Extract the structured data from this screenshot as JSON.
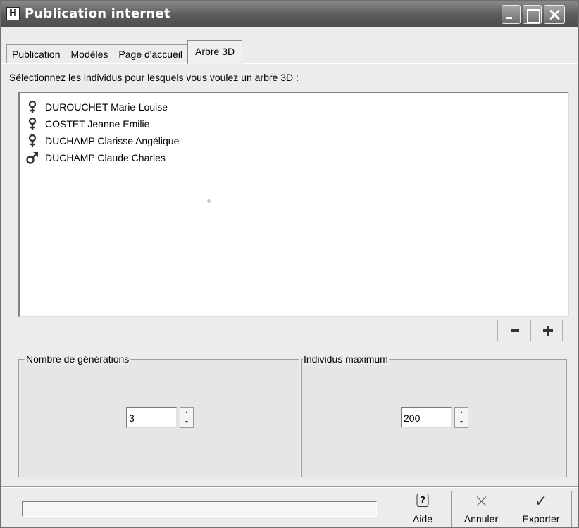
{
  "window": {
    "title": "Publication internet",
    "app_icon_glyph": "H"
  },
  "tabs": [
    {
      "label": "Publication",
      "active": false
    },
    {
      "label": "Modèles",
      "active": false
    },
    {
      "label": "Page d'accueil",
      "active": false
    },
    {
      "label": "Arbre 3D",
      "active": true
    }
  ],
  "instruction": "Sélectionnez les individus pour lesquels vous voulez un arbre 3D :",
  "individuals": [
    {
      "name": "DUROUCHET Marie-Louise",
      "sex": "female",
      "icon": "female-icon"
    },
    {
      "name": "COSTET Jeanne Emilie",
      "sex": "female",
      "icon": "female-icon"
    },
    {
      "name": "DUCHAMP Clarisse Angélique",
      "sex": "female",
      "icon": "female-icon"
    },
    {
      "name": "DUCHAMP Claude Charles",
      "sex": "male",
      "icon": "male-icon"
    }
  ],
  "generations": {
    "label": "Nombre de générations",
    "value": "3"
  },
  "max_individuals": {
    "label": "Individus maximum",
    "value": "200"
  },
  "actions": {
    "help_label": "Aide",
    "cancel_label": "Annuler",
    "export_label": "Exporter"
  },
  "colors": {
    "title_bar": "#5c5c5c",
    "window_bg": "#ececec",
    "list_bg": "#ffffff"
  }
}
